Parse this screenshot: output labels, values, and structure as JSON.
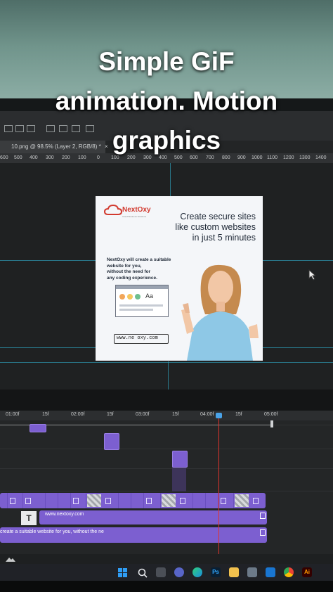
{
  "caption": {
    "line1": "Simple GiF",
    "line2": "animation. Motion",
    "line3": "graphics"
  },
  "document_tab": {
    "label": "10.png @ 98.5% (Layer 2, RGB/8) *",
    "close": "×"
  },
  "ruler": [
    "600",
    "500",
    "400",
    "300",
    "200",
    "100",
    "0",
    "100",
    "200",
    "300",
    "400",
    "500",
    "600",
    "700",
    "800",
    "900",
    "1000",
    "1100",
    "1200",
    "1300",
    "1400"
  ],
  "ad": {
    "brand": "NextOxy",
    "tagline": "Cloud Business Solutions",
    "headline_1": "Create secure sites",
    "headline_2": "like custom websites",
    "headline_3": "in just 5 minutes",
    "body_1": "NextOxy will create a suitable",
    "body_2": "website for you,",
    "body_3": "without the need for",
    "body_4": "any coding experience.",
    "mock_label": "Aa",
    "url": "www.ne  oxy.com",
    "colors": {
      "brand": "#d23a2f",
      "sweater": "#8ec8e6",
      "hair": "#c58a4e"
    }
  },
  "timeline": {
    "ticks": [
      "01:00f",
      "15f",
      "02:00f",
      "15f",
      "03:00f",
      "15f",
      "04:00f",
      "15f",
      "05:00f"
    ],
    "text_layer_icon": "T",
    "text_layer_1": "www.nextoxy.com",
    "text_layer_2": "create a suitable website for you,  without the ne",
    "accent": "#7c5fd0",
    "playhead_color": "#e0332c"
  },
  "taskbar": {
    "icons": [
      "windows-icon",
      "search-icon",
      "task-view-icon",
      "chat-icon",
      "edge-icon",
      "photoshop-icon",
      "file-explorer-icon",
      "store-icon",
      "mail-icon",
      "chrome-icon",
      "illustrator-icon"
    ],
    "ps_label": "Ps",
    "ai_label": "Ai"
  }
}
